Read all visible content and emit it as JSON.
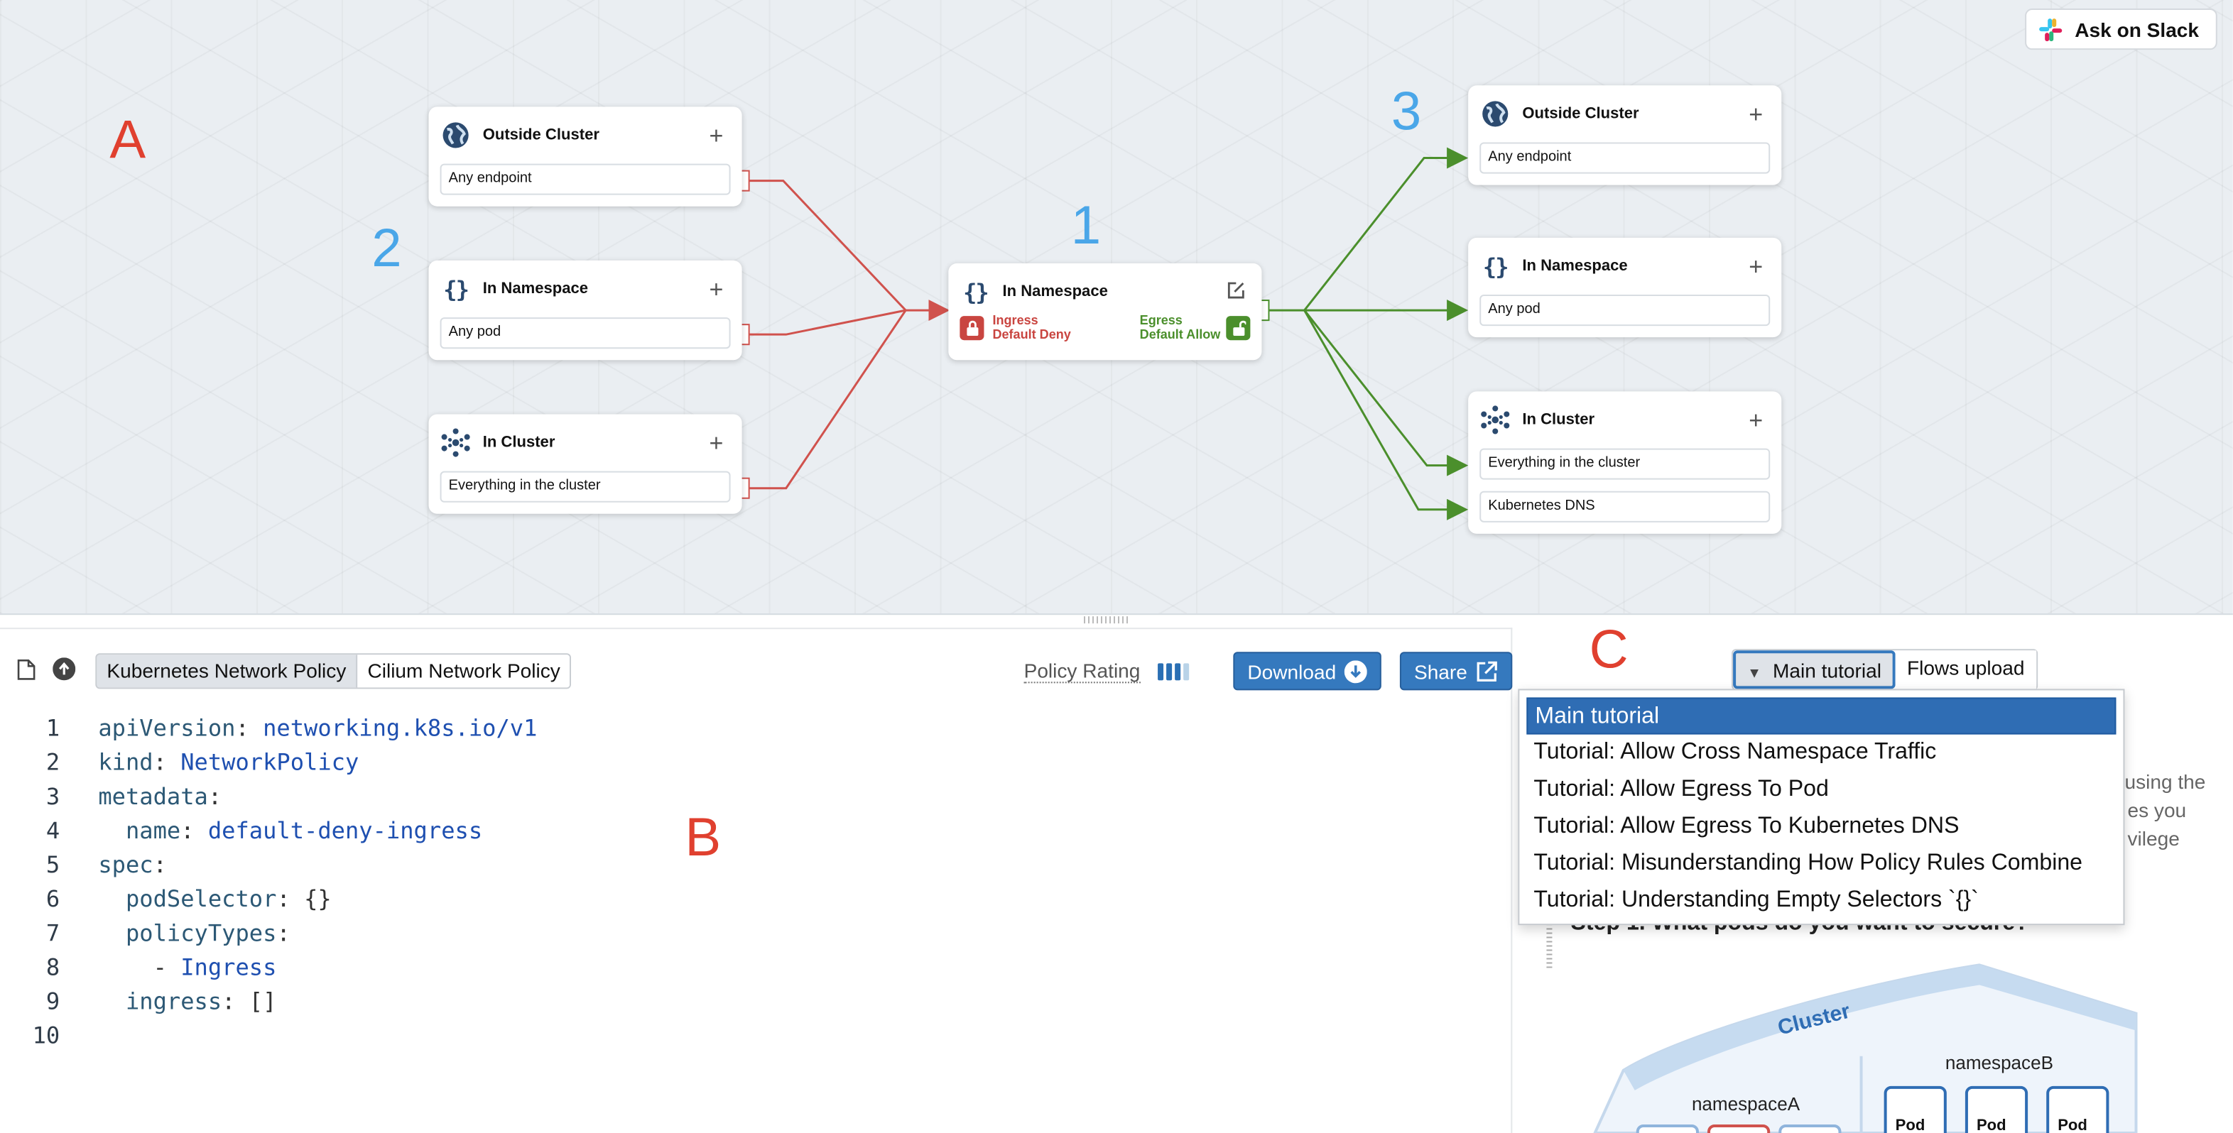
{
  "slack": {
    "label": "Ask on Slack"
  },
  "markers": {
    "a": "A",
    "b": "B",
    "c": "C",
    "n1": "1",
    "n2": "2",
    "n3": "3"
  },
  "ingress_cards": [
    {
      "title": "Outside Cluster",
      "icon": "globe-icon",
      "rules": [
        "Any endpoint"
      ]
    },
    {
      "title": "In Namespace",
      "icon": "braces-icon",
      "rules": [
        "Any pod"
      ]
    },
    {
      "title": "In Cluster",
      "icon": "cluster-icon",
      "rules": [
        "Everything in the cluster"
      ]
    }
  ],
  "center_card": {
    "title": "In Namespace",
    "ingress_line1": "Ingress",
    "ingress_line2": "Default Deny",
    "egress_line1": "Egress",
    "egress_line2": "Default Allow"
  },
  "egress_cards": [
    {
      "title": "Outside Cluster",
      "icon": "globe-icon",
      "rules": [
        "Any endpoint"
      ]
    },
    {
      "title": "In Namespace",
      "icon": "braces-icon",
      "rules": [
        "Any pod"
      ]
    },
    {
      "title": "In Cluster",
      "icon": "cluster-icon",
      "rules": [
        "Everything in the cluster",
        "Kubernetes DNS"
      ]
    }
  ],
  "colors": {
    "deny": "#d0524d",
    "allow": "#4b8f2c",
    "accent": "#3579be"
  },
  "editor": {
    "policy_tabs": [
      "Kubernetes Network Policy",
      "Cilium Network Policy"
    ],
    "active_policy_tab": "Kubernetes Network Policy",
    "rating_label": "Policy Rating",
    "rating_level": "3 of 4",
    "download_label": "Download",
    "share_label": "Share",
    "line_numbers": [
      "1",
      "2",
      "3",
      "4",
      "5",
      "6",
      "7",
      "8",
      "9",
      "10"
    ],
    "code": {
      "l1_key": "apiVersion",
      "l1_val": "networking.k8s.io/v1",
      "l2_key": "kind",
      "l2_val": "NetworkPolicy",
      "l3_key": "metadata",
      "l4_key": "name",
      "l4_val": "default-deny-ingress",
      "l5_key": "spec",
      "l6_key": "podSelector",
      "l6_val": "{}",
      "l7_key": "policyTypes",
      "l8_val": "Ingress",
      "l9_key": "ingress",
      "l9_val": "[]"
    }
  },
  "tutorial": {
    "tabs": [
      "Main tutorial",
      "Flows upload"
    ],
    "active_tab": "Main tutorial",
    "options": [
      "Main tutorial",
      "Tutorial: Allow Cross Namespace Traffic",
      "Tutorial: Allow Egress To Pod",
      "Tutorial: Allow Egress To Kubernetes DNS",
      "Tutorial: Misunderstanding How Policy Rules Combine",
      "Tutorial: Understanding Empty Selectors `{}`"
    ],
    "selected_option": "Main tutorial",
    "bg_text_1": "using the",
    "bg_text_2": "es you",
    "bg_text_3": "vilege",
    "step_heading": "Step 1. What pods do you want to secure?",
    "diagram": {
      "cluster_label": "Cluster",
      "ns_a": "namespaceA",
      "ns_b": "namespaceB",
      "pod_label": "Pod"
    }
  }
}
